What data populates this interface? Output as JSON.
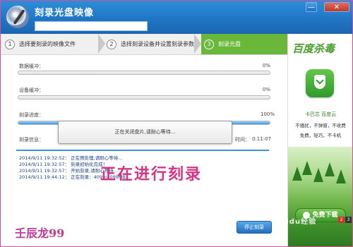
{
  "app": {
    "title": "刻录光盘映像"
  },
  "window": {
    "min_label": "—",
    "close_label": "✕"
  },
  "steps": [
    {
      "num": "1",
      "label": "选择要刻录的映像文件"
    },
    {
      "num": "2",
      "label": "选择刻录设备并设置刻录参数"
    },
    {
      "num": "3",
      "label": "刻录光盘"
    }
  ],
  "progress": {
    "data_buffer": {
      "label": "数据缓冲：",
      "value": "0%",
      "fraction": 0
    },
    "device_buffer": {
      "label": "设备缓冲：",
      "value": "0%",
      "fraction": 0
    },
    "burn_progress": {
      "label": "刻录进度：",
      "value": "100%",
      "fraction": 1
    }
  },
  "info": {
    "label": "刻录信息：",
    "time_label": "时间：",
    "time_value": "0:11:07"
  },
  "modal": {
    "text": "正在关闭盘片,请耐心等待..."
  },
  "log": [
    "2014/9/11 19:32:52：  正在预处理,请耐心等待...",
    "2014/9/11 19:32:57：  刻录初始化完成！",
    "2014/9/11 19:32:57：  开始刻录,请耐心等待...",
    "2014/9/11 19:44:12：  正在刻录：4099/4099MB"
  ],
  "overlay_text": "正在进行刻录",
  "signature": "壬辰龙99",
  "stop_button": "停止刻录",
  "ad": {
    "logo": "百度杀毒",
    "line1": "卡巴芯 百度云",
    "line2": "不骚扰，不弹窗，不收费",
    "line3": "免费，轻巧，不卡机",
    "download": "免费下载",
    "watermark": "Baidu经验",
    "pages": [
      "2",
      "3"
    ]
  },
  "colors": {
    "accent": "#2f8ed8",
    "step_active": "#6ab83a",
    "overlay": "#d63384"
  }
}
